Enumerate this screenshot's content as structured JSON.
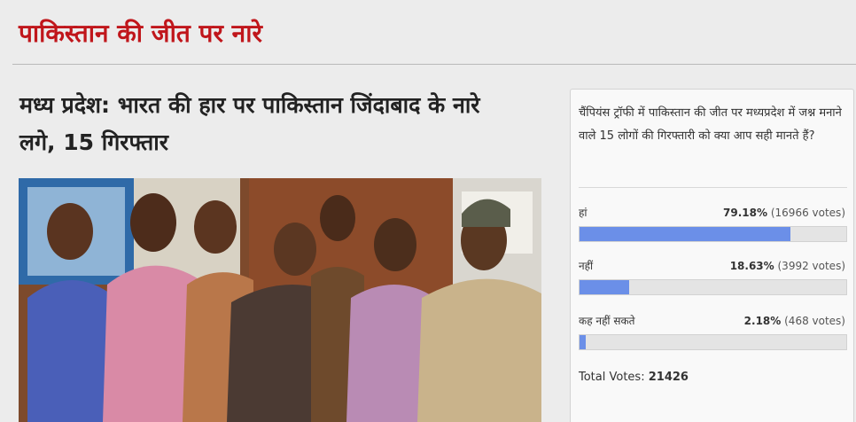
{
  "section": {
    "title": "पाकिस्तान की जीत पर नारे"
  },
  "article": {
    "headline": "मध्य प्रदेश: भारत की हार पर पाकिस्तान जिंदाबाद के नारे लगे, 15 गिरफ्तार"
  },
  "poll": {
    "question": "चैंपियंस ट्रॉफी में पाकिस्तान की जीत पर मध्यप्रदेश में जश्न मनाने वाले 15 लोगों की गिरफ्तारी को क्या आप सही मानते हैं?",
    "options": [
      {
        "label": "हां",
        "percent_text": "79.18%",
        "votes_text": "(16966 votes)",
        "fraction": 0.7918
      },
      {
        "label": "नहीं",
        "percent_text": "18.63%",
        "votes_text": "(3992 votes)",
        "fraction": 0.1863
      },
      {
        "label": "कह नहीं सकते",
        "percent_text": "2.18%",
        "votes_text": "(468 votes)",
        "fraction": 0.0218
      }
    ],
    "total_label": "Total Votes:",
    "total_value": "21426",
    "bar_color": "#6b8fe8"
  }
}
